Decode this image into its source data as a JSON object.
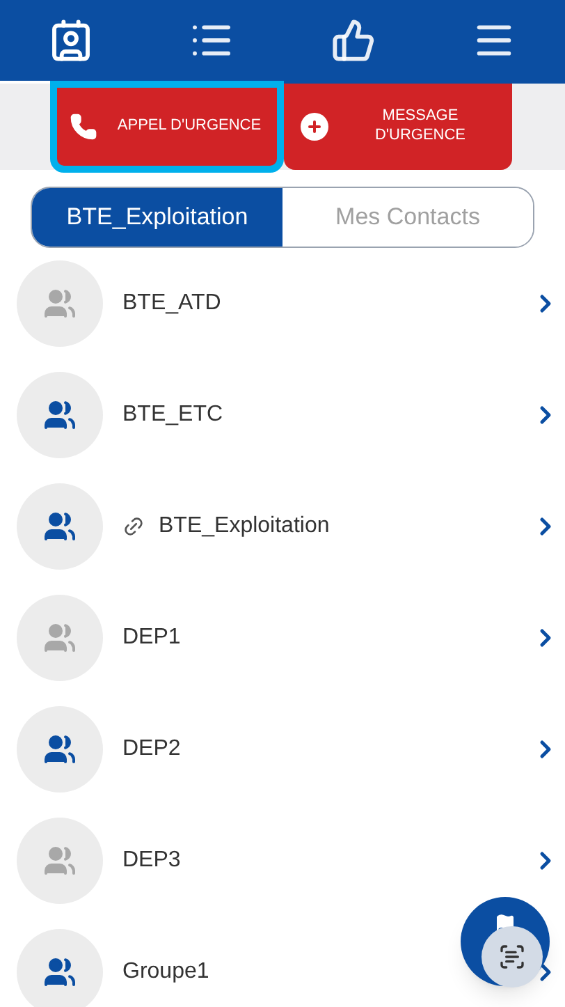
{
  "nav": [
    {
      "kind": "contacts",
      "selected": true
    },
    {
      "kind": "messages",
      "selected": false
    },
    {
      "kind": "thumb",
      "selected": false
    },
    {
      "kind": "menu",
      "selected": false
    }
  ],
  "emergency": [
    {
      "kind": "call",
      "label": "APPEL D'URGENCE",
      "highlighted": true
    },
    {
      "kind": "message",
      "label": "MESSAGE D'URGENCE",
      "highlighted": false
    }
  ],
  "tabs": [
    {
      "label": "BTE_Exploitation",
      "selected": true
    },
    {
      "label": "Mes Contacts",
      "selected": false
    }
  ],
  "groups": [
    {
      "name": "BTE_ATD",
      "active": false,
      "linked": false
    },
    {
      "name": "BTE_ETC",
      "active": true,
      "linked": false
    },
    {
      "name": "BTE_Exploitation",
      "active": true,
      "linked": true
    },
    {
      "name": "DEP1",
      "active": false,
      "linked": false
    },
    {
      "name": "DEP2",
      "active": true,
      "linked": false
    },
    {
      "name": "DEP3",
      "active": false,
      "linked": false
    },
    {
      "name": "Groupe1",
      "active": true,
      "linked": false
    }
  ]
}
